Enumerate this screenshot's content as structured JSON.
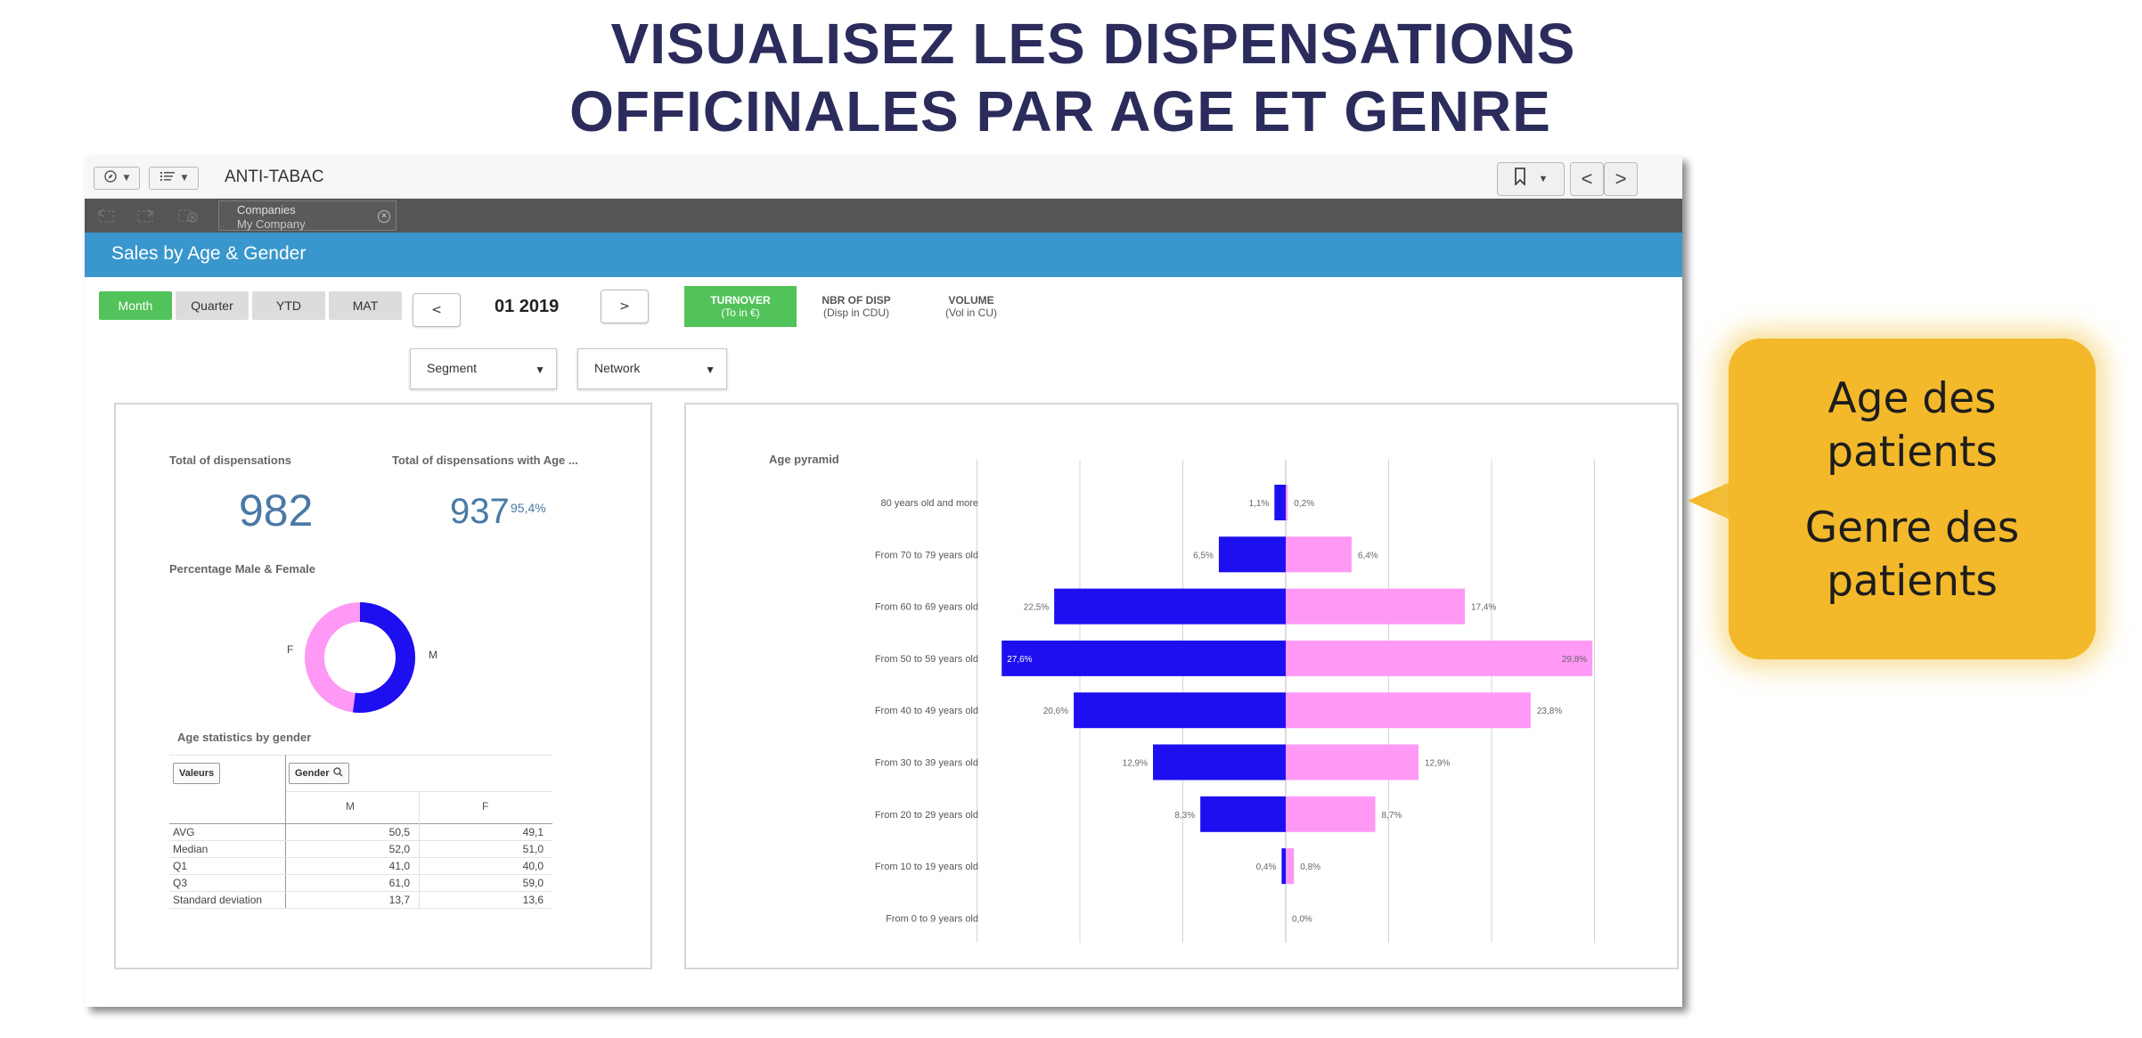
{
  "headline": {
    "line1": "VISUALISEZ LES DISPENSATIONS",
    "line2": "OFFICINALES PAR AGE ET GENRE"
  },
  "toolbar": {
    "app_title": "ANTI-TABAC",
    "nav_prev": "<",
    "nav_next": ">"
  },
  "selections": {
    "field": "Companies",
    "value": "My Company"
  },
  "sheet": {
    "title": "Sales by Age & Gender"
  },
  "period_buttons": [
    {
      "label": "Month",
      "active": true
    },
    {
      "label": "Quarter",
      "active": false
    },
    {
      "label": "YTD",
      "active": false
    },
    {
      "label": "MAT",
      "active": false
    }
  ],
  "period": {
    "prev": "<",
    "value": "01 2019",
    "next": ">"
  },
  "measures": [
    {
      "line1": "TURNOVER",
      "line2": "(To in €)",
      "active": true
    },
    {
      "line1": "NBR OF DISP",
      "line2": "(Disp in CDU)",
      "active": false
    },
    {
      "line1": "VOLUME",
      "line2": "(Vol in CU)",
      "active": false
    }
  ],
  "filters": {
    "segment": "Segment",
    "network": "Network"
  },
  "kpis": {
    "total_title": "Total of dispensations",
    "total_value": "982",
    "age_title": "Total of dispensations with Age ...",
    "age_value": "937",
    "age_pct": "95,4%"
  },
  "gender_donut": {
    "title": "Percentage Male & Female",
    "male_label": "M",
    "female_label": "F",
    "male_share": 0.52,
    "male_color": "#1e0ff0",
    "female_color": "#ff99f5"
  },
  "age_stats": {
    "title": "Age statistics by gender",
    "chip_values": "Valeurs",
    "chip_gender": "Gender",
    "col_m": "M",
    "col_f": "F",
    "rows": [
      {
        "label": "AVG",
        "m": "50,5",
        "f": "49,1"
      },
      {
        "label": "Median",
        "m": "52,0",
        "f": "51,0"
      },
      {
        "label": "Q1",
        "m": "41,0",
        "f": "40,0"
      },
      {
        "label": "Q3",
        "m": "61,0",
        "f": "59,0"
      },
      {
        "label": "Standard deviation",
        "m": "13,7",
        "f": "13,6"
      }
    ]
  },
  "chart_data": {
    "type": "bar",
    "title": "Age pyramid",
    "orientation": "horizontal-diverging",
    "categories": [
      "80 years old and more",
      "From 70 to 79 years old",
      "From 60 to 69 years old",
      "From 50 to 59 years old",
      "From 40 to 49 years old",
      "From 30 to 39 years old",
      "From 20 to 29 years old",
      "From 10 to 19 years old",
      "From 0 to 9 years old"
    ],
    "series": [
      {
        "values": [
          1.1,
          6.5,
          22.5,
          27.6,
          20.6,
          12.9,
          8.3,
          0.4,
          0.0
        ],
        "labels": [
          "1,1%",
          "6,5%",
          "22,5%",
          "27,6%",
          "20,6%",
          "12,9%",
          "8,3%",
          "0,4%",
          ""
        ],
        "color": "#1e0ff0",
        "side": "left"
      },
      {
        "values": [
          0.2,
          6.4,
          17.4,
          29.8,
          23.8,
          12.9,
          8.7,
          0.8,
          0.0
        ],
        "labels": [
          "0,2%",
          "6,4%",
          "17,4%",
          "29,8%",
          "23,8%",
          "12,9%",
          "8,7%",
          "0,8%",
          "0,0%"
        ],
        "color": "#ff99f5",
        "side": "right"
      }
    ],
    "xlim": [
      -30,
      30
    ],
    "grid": true
  },
  "callout": {
    "line1": "Age des",
    "line2": "patients",
    "line3": "Genre des",
    "line4": "patients"
  }
}
